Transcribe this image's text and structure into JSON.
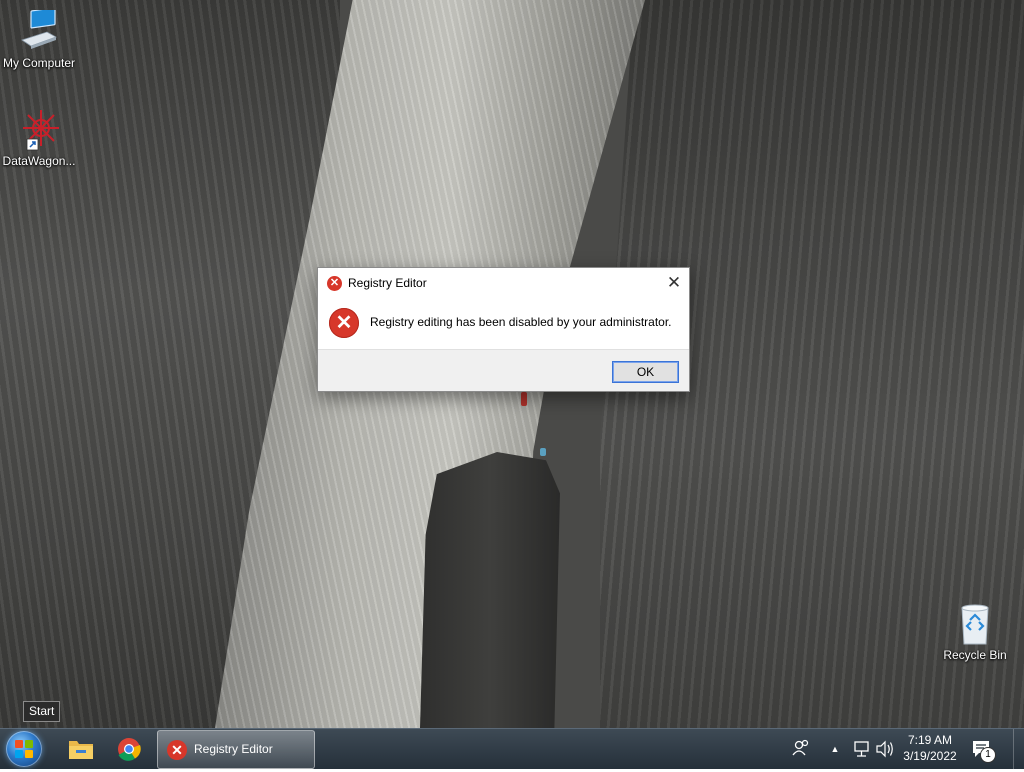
{
  "desktop": {
    "icons": [
      {
        "label": "My Computer"
      },
      {
        "label": "DataWagon..."
      },
      {
        "label": "Recycle Bin"
      }
    ]
  },
  "dialog": {
    "title": "Registry Editor",
    "message": "Registry editing has been disabled by your administrator.",
    "ok_label": "OK",
    "close_glyph": "✕",
    "icon": "error-icon"
  },
  "tooltip": {
    "text": "Start"
  },
  "taskbar": {
    "pinned": [
      "file-explorer-icon",
      "chrome-icon"
    ],
    "active_task": {
      "label": "Registry Editor"
    },
    "tray": {
      "time": "7:19 AM",
      "date": "3/19/2022",
      "notification_count": "1"
    }
  },
  "colors": {
    "error_red": "#d7372a",
    "ok_button_border": "#3b74d6"
  }
}
